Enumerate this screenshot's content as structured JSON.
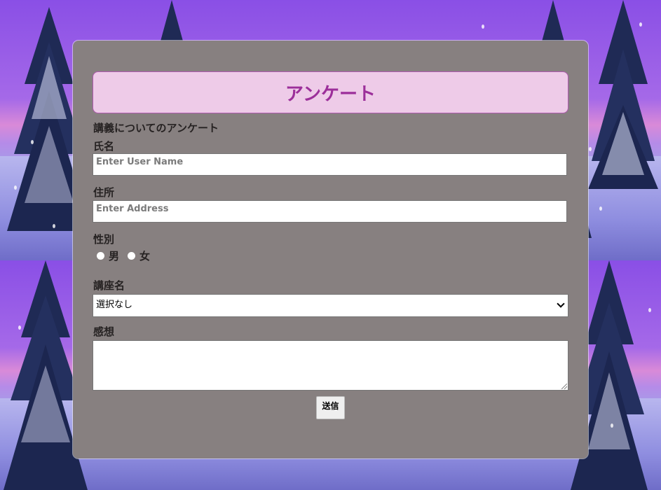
{
  "form": {
    "title": "アンケート",
    "subtitle": "講義についてのアンケート",
    "name_label": "氏名",
    "name_placeholder": "Enter User Name",
    "address_label": "住所",
    "address_placeholder": "Enter Address",
    "gender_label": "性別",
    "gender_options": [
      "男",
      "女"
    ],
    "course_label": "講座名",
    "course_selected": "選択なし",
    "comment_label": "感想",
    "submit_label": "送信"
  },
  "colors": {
    "card": "#878080",
    "title_bg": "#eecbe8",
    "title_text": "#9c2f9a",
    "sky": "#8a4fe6"
  }
}
